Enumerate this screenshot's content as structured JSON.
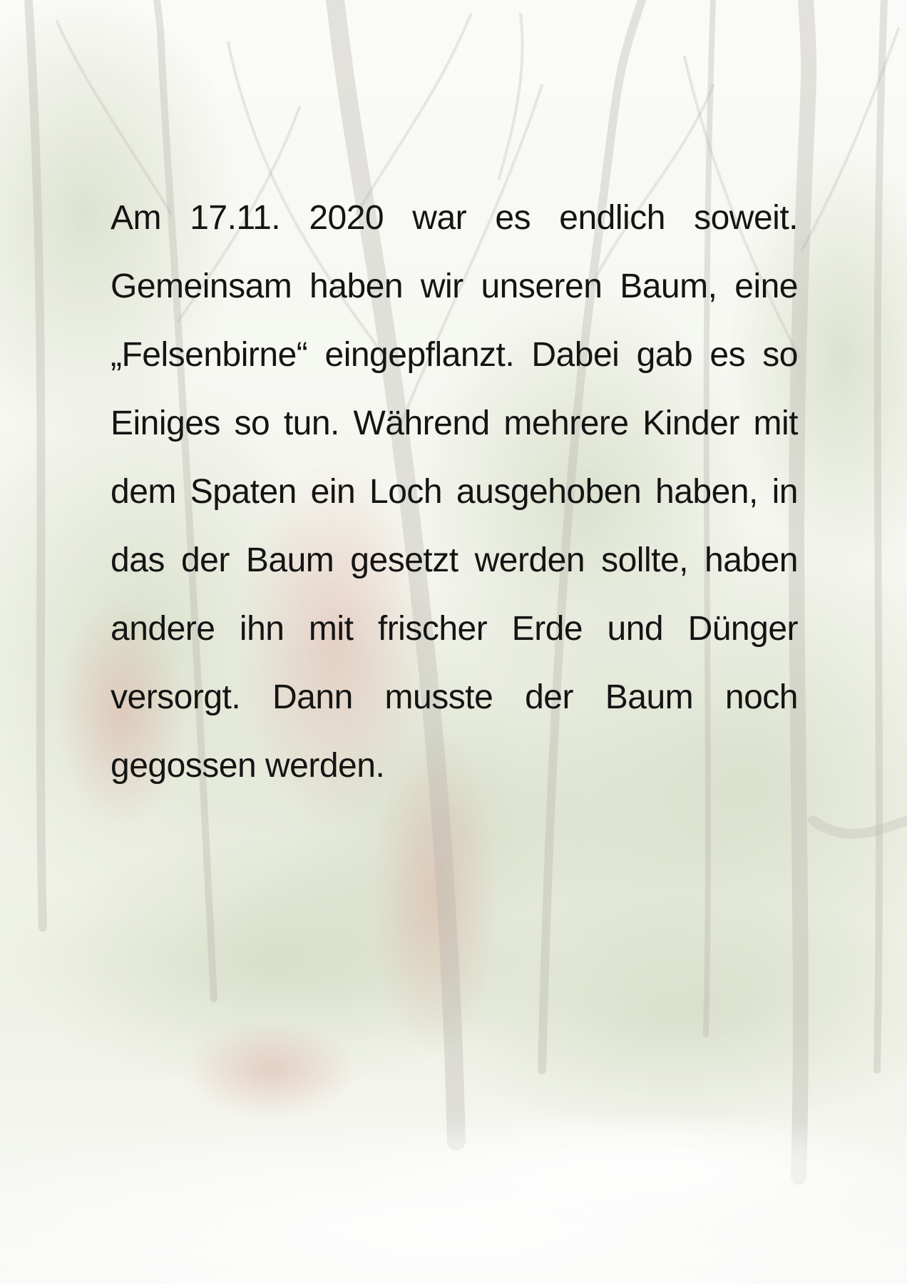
{
  "document": {
    "lines": [
      "Am 17.11. 2020 war es endlich soweit.",
      "Gemeinsam haben wir unseren Baum, eine",
      "„Felsenbirne“ eingepflanzt. Dabei gab es so",
      "Einiges so tun. Während mehrere Kinder mit",
      "dem Spaten ein Loch ausgehoben haben, in",
      "das der Baum gesetzt werden sollte, haben",
      "andere ihn mit frischer Erde und Dünger",
      "versorgt. Dann musste der Baum noch",
      "gegossen werden."
    ]
  },
  "background": {
    "icon": "faded-forest-photo",
    "colors": {
      "base": "#f4f5ef",
      "foliage": "#a9b88a",
      "autumn": "#c98a78",
      "trunk": "#8f8a80",
      "path": "#f7f7f5"
    }
  }
}
